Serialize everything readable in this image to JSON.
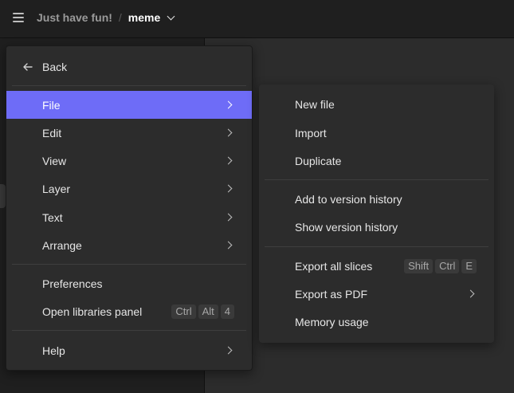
{
  "topbar": {
    "project": "Just have fun!",
    "separator": "/",
    "file": "meme"
  },
  "menu": {
    "back_label": "Back",
    "items": [
      {
        "label": "File"
      },
      {
        "label": "Edit"
      },
      {
        "label": "View"
      },
      {
        "label": "Layer"
      },
      {
        "label": "Text"
      },
      {
        "label": "Arrange"
      }
    ],
    "preferences_label": "Preferences",
    "libraries_label": "Open libraries panel",
    "libraries_shortcut": [
      "Ctrl",
      "Alt",
      "4"
    ],
    "help_label": "Help"
  },
  "submenu": {
    "new_file": "New file",
    "import": "Import",
    "duplicate": "Duplicate",
    "add_version": "Add to version history",
    "show_version": "Show version history",
    "export_slices": "Export all slices",
    "export_slices_shortcut": [
      "Shift",
      "Ctrl",
      "E"
    ],
    "export_pdf": "Export as PDF",
    "memory_usage": "Memory usage"
  },
  "colors": {
    "accent": "#6e6cf7",
    "menu_bg": "#2c2c2c",
    "topbar_bg": "#1f1f1f"
  }
}
